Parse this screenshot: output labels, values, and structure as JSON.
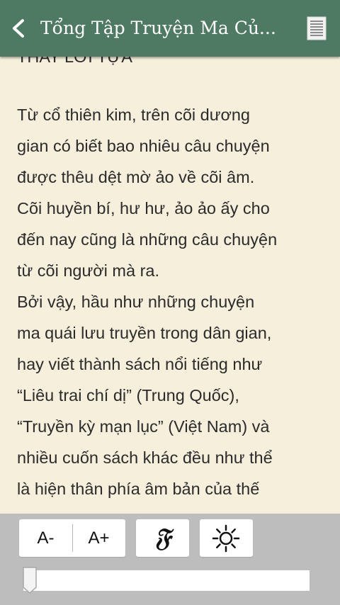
{
  "header": {
    "title": "Tổng Tập Truyện Ma Củ..."
  },
  "content": {
    "cut_line": "THAY LỜI TỰA",
    "lines": [
      " Từ cổ thiên kim, trên cõi dương",
      "gian có biết bao nhiêu câu chuyện",
      "được thêu dệt mờ ảo về cõi âm.",
      "Cõi huyền bí, hư hư, ảo ảo ấy cho",
      "đến nay cũng là những câu chuyện",
      "từ cõi người mà ra.",
      " Bởi vậy, hầu như những chuyện",
      "ma quái lưu truyền trong dân gian,",
      "hay viết thành sách nổi tiếng như",
      "“Liêu trai chí dị” (Trung Quốc),",
      "“Truyền kỳ mạn lục” (Việt Nam) và",
      "nhiều cuốn sách khác đều như thể",
      "là hiện thân phía âm bản của thế"
    ]
  },
  "toolbar": {
    "font_decrease_label": "A-",
    "font_increase_label": "A+",
    "font_icon_glyph": "𝔉",
    "brightness_icon": "sun-icon",
    "back_icon": "chevron-left-icon",
    "toc_icon": "list-icon"
  },
  "slider": {
    "value_fraction": 0.0
  },
  "colors": {
    "header_bg": "#4e7a63",
    "page_bg": "#f6efdc",
    "text": "#2b2b2b",
    "toolbar_bg": "#bdbdbd"
  }
}
